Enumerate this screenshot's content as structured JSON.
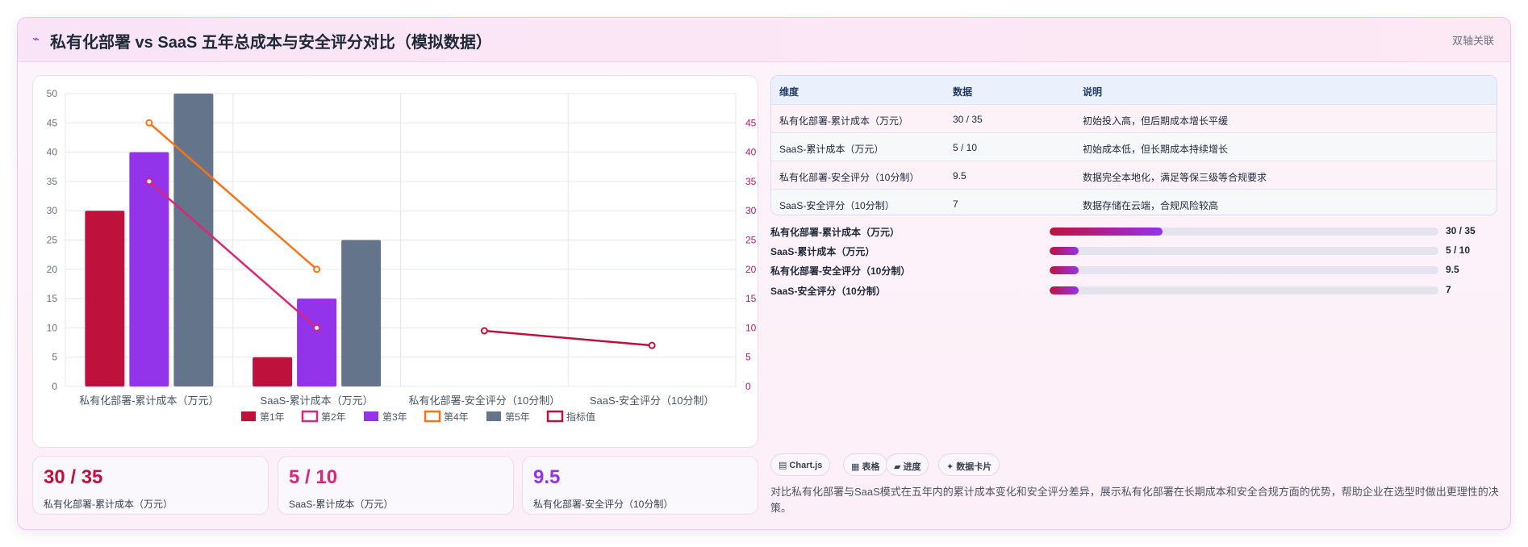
{
  "header": {
    "icon": "chart-line-icon",
    "title": "私有化部署 vs SaaS 五年总成本与安全评分对比（模拟数据）",
    "link": "双轴关联"
  },
  "colors": {
    "year1": "#be123c",
    "year2": "#db2777",
    "year3": "#9333ea",
    "year4": "#f97316",
    "year5": "#64748b",
    "indicator": "#be123c"
  },
  "chart_data": {
    "type": "bar",
    "categories": [
      "私有化部署-累计成本（万元）",
      "SaaS-累计成本（万元）",
      "私有化部署-安全评分（10分制）",
      "SaaS-安全评分（10分制）"
    ],
    "ylim": [
      0,
      50
    ],
    "yticks": [
      0,
      5,
      10,
      15,
      20,
      25,
      30,
      35,
      40,
      45,
      50
    ],
    "y2lim": [
      0,
      45
    ],
    "y2ticks": [
      0,
      5,
      10,
      15,
      20,
      25,
      30,
      35,
      40,
      45
    ],
    "grid": true,
    "legend_position": "bottom",
    "bar_series": [
      {
        "name": "第1年",
        "color": "#be123c",
        "values": [
          30,
          5,
          null,
          null
        ]
      },
      {
        "name": "第3年",
        "color": "#9333ea",
        "values": [
          40,
          15,
          null,
          null
        ]
      },
      {
        "name": "第5年",
        "color": "#64748b",
        "values": [
          50,
          25,
          null,
          null
        ]
      }
    ],
    "line_series": [
      {
        "name": "第2年",
        "color": "#db2777",
        "axis": "y2",
        "values": [
          35,
          10,
          null,
          null
        ]
      },
      {
        "name": "第4年",
        "color": "#f97316",
        "axis": "y2",
        "values": [
          45,
          20,
          null,
          null
        ]
      },
      {
        "name": "指标值",
        "color": "#be123c",
        "axis": "y2",
        "values": [
          null,
          null,
          9.5,
          7
        ]
      }
    ],
    "legend": [
      {
        "name": "第1年",
        "color": "#be123c",
        "style": "filled"
      },
      {
        "name": "第2年",
        "color": "#db2777",
        "style": "outline"
      },
      {
        "name": "第3年",
        "color": "#9333ea",
        "style": "filled"
      },
      {
        "name": "第4年",
        "color": "#f97316",
        "style": "outline"
      },
      {
        "name": "第5年",
        "color": "#64748b",
        "style": "filled"
      },
      {
        "name": "指标值",
        "color": "#be123c",
        "style": "outline"
      }
    ]
  },
  "table": {
    "headers": [
      "维度",
      "数据",
      "说明"
    ],
    "rows": [
      [
        "私有化部署-累计成本（万元）",
        "30 / 35",
        "初始投入高，但后期成本增长平缓"
      ],
      [
        "SaaS-累计成本（万元）",
        "5 / 10",
        "初始成本低，但长期成本持续增长"
      ],
      [
        "私有化部署-安全评分（10分制）",
        "9.5",
        "数据完全本地化，满足等保三级等合规要求"
      ],
      [
        "SaaS-安全评分（10分制）",
        "7",
        "数据存储在云端，合规风险较高"
      ]
    ]
  },
  "progress": [
    {
      "label": "私有化部署-累计成本（万元）",
      "value": "30 / 35",
      "fill": 0.29
    },
    {
      "label": "SaaS-累计成本（万元）",
      "value": "5 / 10",
      "fill": 0.075
    },
    {
      "label": "私有化部署-安全评分（10分制）",
      "value": "9.5",
      "fill": 0.075
    },
    {
      "label": "SaaS-安全评分（10分制）",
      "value": "7",
      "fill": 0.075
    }
  ],
  "stats": [
    {
      "value": "30 / 35",
      "label": "私有化部署-累计成本（万元）",
      "color": "#be123c"
    },
    {
      "value": "5 / 10",
      "label": "SaaS-累计成本（万元）",
      "color": "#db2777"
    },
    {
      "value": "9.5",
      "label": "私有化部署-安全评分（10分制）",
      "color": "#9333ea"
    }
  ],
  "chips": [
    {
      "icon": "bar-chart-icon",
      "glyph": "▤",
      "label": "Chart.js"
    },
    {
      "icon": "table-icon",
      "glyph": "▦",
      "label": "表格"
    },
    {
      "icon": "progress-icon",
      "glyph": "▰",
      "label": "进度"
    },
    {
      "icon": "sparkle-icon",
      "glyph": "✦",
      "label": "数据卡片"
    }
  ],
  "description": "对比私有化部署与SaaS模式在五年内的累计成本变化和安全评分差异，展示私有化部署在长期成本和安全合规方面的优势，帮助企业在选型时做出更理性的决策。"
}
